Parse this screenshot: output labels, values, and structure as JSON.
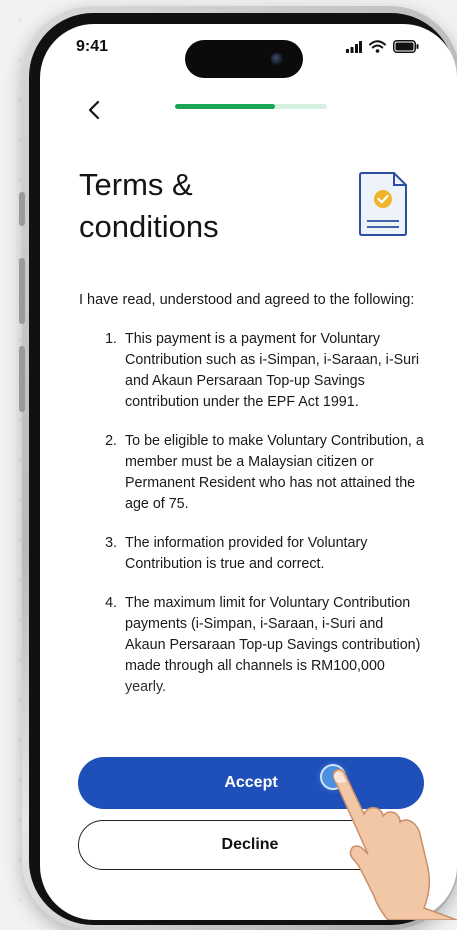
{
  "status_bar": {
    "time": "9:41"
  },
  "progress": {
    "fraction": 0.66
  },
  "title": "Terms & conditions",
  "intro": "I have read, understood and agreed to the following:",
  "terms": [
    {
      "num": "1.",
      "text": "This payment is a payment for Voluntary Contribution such as i-Simpan, i-Saraan, i-Suri and Akaun Persaraan Top-up Savings contribution under the EPF Act 1991."
    },
    {
      "num": "2.",
      "text": "To be eligible to make Voluntary Contribution, a member must be a Malaysian citizen or Permanent Resident who has not attained the age of 75."
    },
    {
      "num": "3.",
      "text": "The information provided for Voluntary Contribution is true and correct."
    },
    {
      "num": "4.",
      "text": "The maximum limit for Voluntary Contribution payments (i-Simpan, i-Saraan, i-Suri and Akaun Persaraan Top-up Savings contribution) made through all channels is RM100,000 yearly."
    }
  ],
  "buttons": {
    "accept": "Accept",
    "decline": "Decline"
  },
  "icons": {
    "back": "chevron-left-icon",
    "document": "document-check-icon",
    "signal": "signal-icon",
    "wifi": "wifi-icon",
    "battery": "battery-icon",
    "hand": "pointing-hand-icon"
  },
  "colors": {
    "primary": "#1f4fb8",
    "progress": "#1aa656",
    "progress_track": "#d6f1e0",
    "icon_accent": "#f0b429"
  }
}
